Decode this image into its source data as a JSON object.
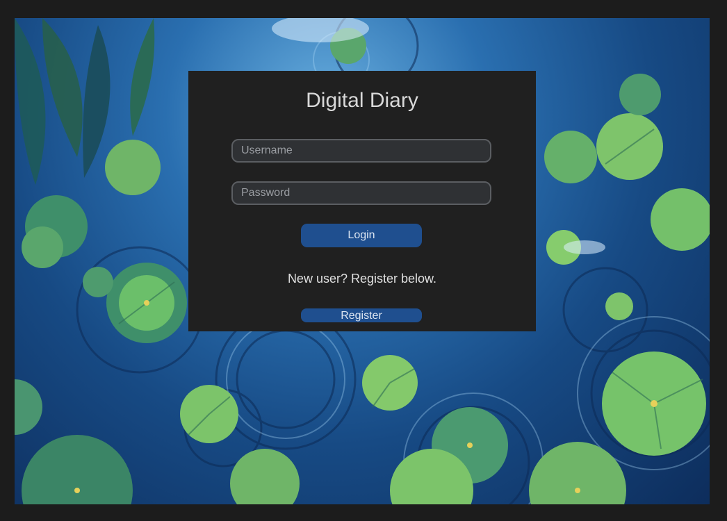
{
  "app": {
    "title": "Digital Diary"
  },
  "login_form": {
    "username_placeholder": "Username",
    "username_value": "",
    "password_placeholder": "Password",
    "password_value": "",
    "login_label": "Login",
    "register_prompt": "New user? Register below.",
    "register_label": "Register"
  },
  "theme": {
    "frame_color": "#1c1c1c",
    "panel_color": "#202020",
    "button_color": "#1f4f8f",
    "background_description": "water-lily-pond-illustration"
  }
}
